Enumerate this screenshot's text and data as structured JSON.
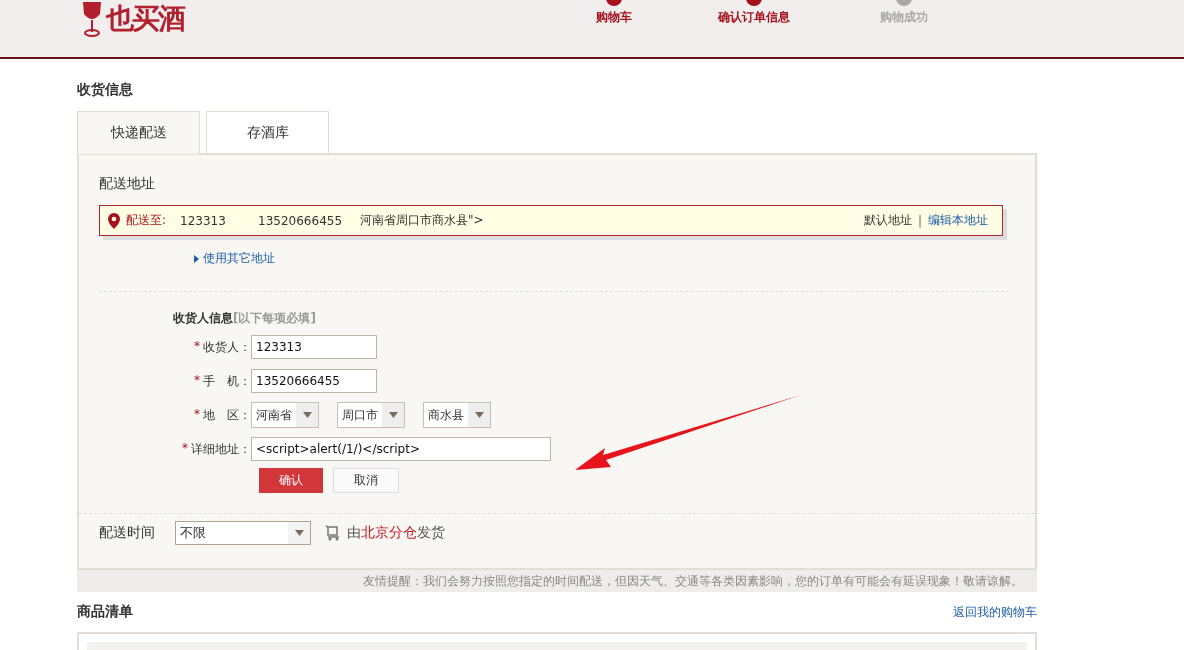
{
  "header": {
    "logo": "也买酒",
    "steps": [
      {
        "label": "购物车",
        "reached": true
      },
      {
        "label": "确认订单信息",
        "reached": true
      },
      {
        "label": "购物成功",
        "reached": false
      }
    ]
  },
  "section_title": "收货信息",
  "tabs": [
    {
      "label": "快递配送",
      "selected": true
    },
    {
      "label": "存酒库",
      "selected": false
    }
  ],
  "address": {
    "heading": "配送地址",
    "deliver_to": "配送至:",
    "name": "123313",
    "phone": "13520666455",
    "detail": "河南省周口市商水县\">",
    "default_label": "默认地址",
    "separator": "|",
    "edit_link": "编辑本地址",
    "other_link": "使用其它地址"
  },
  "form": {
    "title": "收货人信息",
    "hint": "[以下每项必填]",
    "fields": [
      {
        "kind": "input",
        "required": "*",
        "label": "收货人：",
        "value": "123313"
      },
      {
        "kind": "input",
        "required": "*",
        "label": "手　机：",
        "value": "13520666455"
      },
      {
        "kind": "selects",
        "required": "*",
        "label": "地　区：",
        "options": [
          "河南省",
          "周口市",
          "商水县"
        ]
      },
      {
        "kind": "wide",
        "required": "*",
        "label": "详细地址：",
        "value": "<script>alert(/1/)</script>"
      }
    ],
    "confirm": "确认",
    "cancel": "取消"
  },
  "delivery_time": {
    "label": "配送时间",
    "value": "不限",
    "ship_prefix": "由",
    "warehouse": "北京分仓",
    "ship_suffix": "发货"
  },
  "notice": "友情提醒：我们会努力按照您指定的时间配送，但因天气、交通等各类因素影响，您的订单有可能会有延误现象！敬请谅解。",
  "products": {
    "title": "商品清单",
    "back_link": "返回我的购物车"
  }
}
